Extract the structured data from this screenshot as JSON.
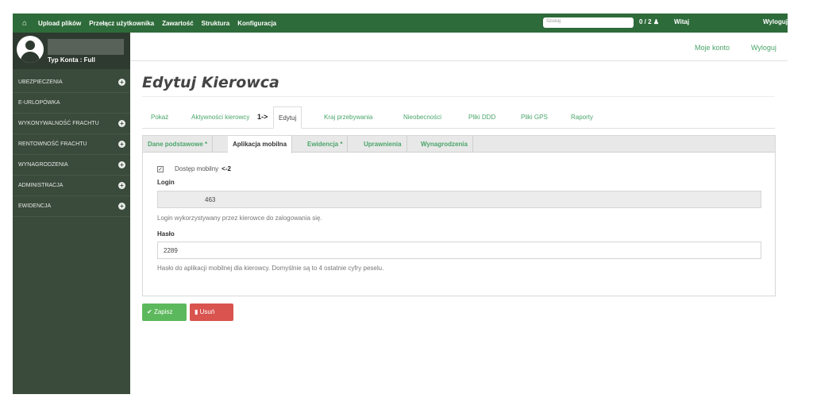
{
  "topbar": {
    "home_icon": "home-icon",
    "items": [
      "Upload plików",
      "Przełącz użytkownika",
      "Zawartość",
      "Struktura",
      "Konfiguracja"
    ],
    "search_placeholder": "Szukaj",
    "counter": "0 / 2",
    "counter_icon": "users-icon",
    "greeting": "Witaj",
    "logout": "Wyloguj"
  },
  "sidebar": {
    "account_type": "Typ Konta : Full",
    "items": [
      {
        "label": "UBEZPIECZENIA",
        "expandable": true
      },
      {
        "label": "E-URLOPÓWKA",
        "expandable": false
      },
      {
        "label": "WYKONYWALNOŚĆ FRACHTU",
        "expandable": true
      },
      {
        "label": "RENTOWNOŚĆ FRACHTU",
        "expandable": true
      },
      {
        "label": "WYNAGRODZENIA",
        "expandable": true
      },
      {
        "label": "ADMINISTRACJA",
        "expandable": true
      },
      {
        "label": "EWIDENCJA",
        "expandable": true
      }
    ]
  },
  "subheader": {
    "my_account": "Moje konto",
    "logout": "Wyloguj"
  },
  "page": {
    "title": "Edytuj Kierowca",
    "main_tabs": [
      "Pokaż",
      "Aktywności kierowcy",
      "Edytuj",
      "Kraj przebywania",
      "Nieobecności",
      "Pliki DDD",
      "Pliki GPS",
      "Raporty"
    ],
    "active_main_tab": "Edytuj",
    "marker_1": "1->",
    "sub_tabs": [
      "Dane podstawowe *",
      "Aplikacja mobilna",
      "Ewidencja *",
      "Uprawnienia",
      "Wynagrodzenia"
    ],
    "active_sub_tab": "Aplikacja mobilna"
  },
  "form": {
    "mobile_access_label": "Dostęp mobilny",
    "mobile_access_checked": true,
    "marker_2": "<-2",
    "login_label": "Login",
    "login_value": "463",
    "login_help": "Login wykorzystywany przez kierowce do zalogowania się.",
    "password_label": "Hasło",
    "password_value": "2289",
    "password_help": "Hasło do aplikacji mobilnej dla kierowcy. Domyślnie są to 4 ostatnie cyfry peselu."
  },
  "actions": {
    "save": "Zapisz",
    "delete": "Usuń"
  },
  "colors": {
    "topbar": "#2e6b3a",
    "sidebar": "#3a4a3b",
    "link": "#4aa56a",
    "save": "#5cb85c",
    "delete": "#d9534f"
  }
}
